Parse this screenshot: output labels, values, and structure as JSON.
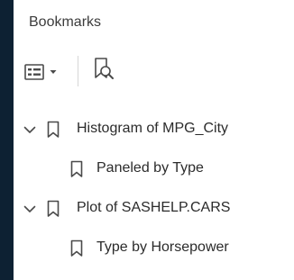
{
  "panel": {
    "title": "Bookmarks"
  },
  "toolbar": {
    "options_icon": "options-list-icon",
    "options_chevron": "chevron-down-icon",
    "find_icon": "find-current-bookmark-icon"
  },
  "bookmarks": [
    {
      "label": "Histogram of MPG_City",
      "expanded": true,
      "children": [
        {
          "label": "Paneled by Type"
        }
      ]
    },
    {
      "label": "Plot of SASHELP.CARS",
      "expanded": true,
      "children": [
        {
          "label": "Type by Horsepower"
        }
      ]
    }
  ],
  "colors": {
    "background": "#0d2133",
    "panel": "#ffffff",
    "text": "#2b2b2b",
    "icon": "#5a5a5a"
  }
}
